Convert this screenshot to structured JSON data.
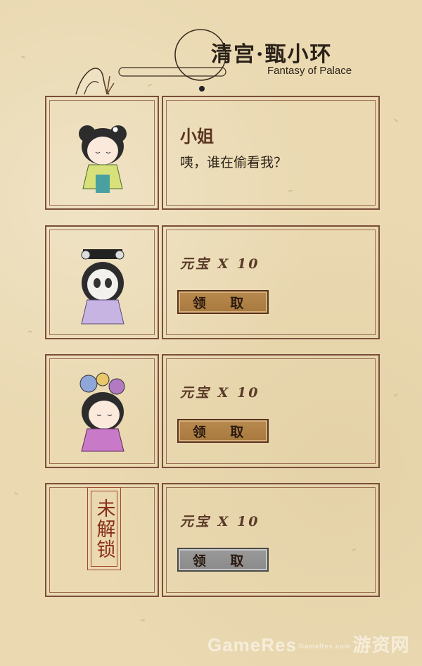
{
  "header": {
    "title": "清宫·甄小环",
    "subtitle": "Fantasy of Palace"
  },
  "cards": [
    {
      "type": "character",
      "name": "小姐",
      "line": "咦，谁在偷看我？"
    },
    {
      "type": "reward",
      "reward_label": "元宝 X 10",
      "button_label": "领 取",
      "enabled": true
    },
    {
      "type": "reward",
      "reward_label": "元宝 X 10",
      "button_label": "领 取",
      "enabled": true
    },
    {
      "type": "locked",
      "lock_label": "未解锁",
      "reward_label": "元宝 X 10",
      "button_label": "领 取",
      "enabled": false
    }
  ],
  "watermark": {
    "text": "GameRes",
    "small": "GameRes.com",
    "cn": "游资网"
  },
  "colors": {
    "background": "#ead9b1",
    "frame": "#7a4e3a",
    "button": "#a8793e",
    "button_disabled": "#8a8a8a"
  }
}
